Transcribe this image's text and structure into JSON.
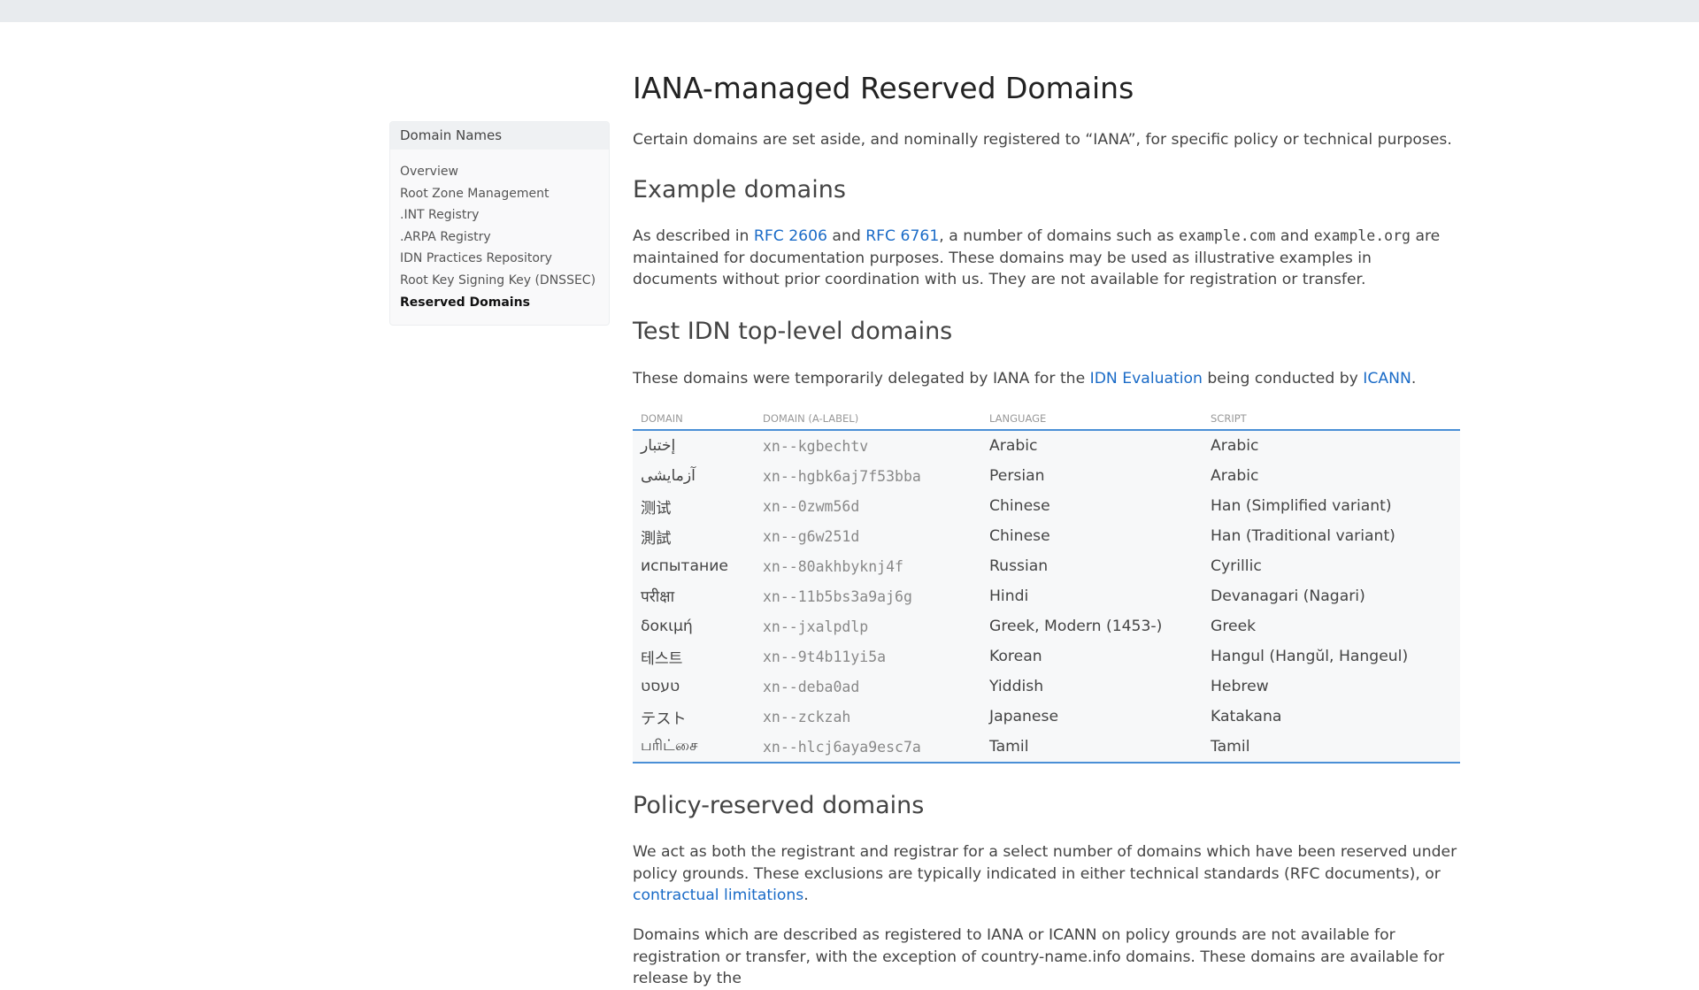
{
  "sidebar": {
    "heading": "Domain Names",
    "items": [
      {
        "label": "Overview"
      },
      {
        "label": "Root Zone Management"
      },
      {
        "label": ".INT Registry"
      },
      {
        "label": ".ARPA Registry"
      },
      {
        "label": "IDN Practices Repository"
      },
      {
        "label": "Root Key Signing Key (DNSSEC)"
      },
      {
        "label": "Reserved Domains"
      }
    ]
  },
  "main": {
    "title": "IANA-managed Reserved Domains",
    "intro": "Certain domains are set aside, and nominally registered to “IANA”, for specific policy or technical purposes.",
    "example": {
      "heading": "Example domains",
      "t1": "As described in ",
      "link1": "RFC 2606",
      "t2": " and ",
      "link2": "RFC 6761",
      "t3": ", a number of domains such as ",
      "code1": "example.com",
      "t4": " and ",
      "code2": "example.org",
      "t5": " are maintained for documentation purposes. These domains may be used as illustrative examples in documents without prior coordination with us. They are not available for registration or transfer."
    },
    "test_idn": {
      "heading": "Test IDN top-level domains",
      "t1": "These domains were temporarily delegated by IANA for the ",
      "link1": "IDN Evaluation",
      "t2": " being conducted by ",
      "link2": "ICANN",
      "t3": ".",
      "columns": {
        "domain": "DOMAIN",
        "alabel": "DOMAIN (A-LABEL)",
        "language": "LANGUAGE",
        "script": "SCRIPT"
      },
      "rows": [
        {
          "domain": "إختبار",
          "alabel": "xn--kgbechtv",
          "language": "Arabic",
          "script": "Arabic"
        },
        {
          "domain": "آزمایشی",
          "alabel": "xn--hgbk6aj7f53bba",
          "language": "Persian",
          "script": "Arabic"
        },
        {
          "domain": "测试",
          "alabel": "xn--0zwm56d",
          "language": "Chinese",
          "script": "Han (Simplified variant)"
        },
        {
          "domain": "測試",
          "alabel": "xn--g6w251d",
          "language": "Chinese",
          "script": "Han (Traditional variant)"
        },
        {
          "domain": "испытание",
          "alabel": "xn--80akhbyknj4f",
          "language": "Russian",
          "script": "Cyrillic"
        },
        {
          "domain": "परीक्षा",
          "alabel": "xn--11b5bs3a9aj6g",
          "language": "Hindi",
          "script": "Devanagari (Nagari)"
        },
        {
          "domain": "δοκιμή",
          "alabel": "xn--jxalpdlp",
          "language": "Greek, Modern (1453-)",
          "script": "Greek"
        },
        {
          "domain": "테스트",
          "alabel": "xn--9t4b11yi5a",
          "language": "Korean",
          "script": "Hangul (Hangŭl, Hangeul)"
        },
        {
          "domain": "טעסט",
          "alabel": "xn--deba0ad",
          "language": "Yiddish",
          "script": "Hebrew"
        },
        {
          "domain": "テスト",
          "alabel": "xn--zckzah",
          "language": "Japanese",
          "script": "Katakana"
        },
        {
          "domain": "பரிட்சை",
          "alabel": "xn--hlcj6aya9esc7a",
          "language": "Tamil",
          "script": "Tamil"
        }
      ]
    },
    "policy": {
      "heading": "Policy-reserved domains",
      "p1_t1": "We act as both the registrant and registrar for a select number of domains which have been reserved under policy grounds. These exclusions are typically indicated in either technical standards (RFC documents), or ",
      "p1_link": "contractual limitations",
      "p1_t2": ".",
      "p2": "Domains which are described as registered to IANA or ICANN on policy grounds are not available for registration or transfer, with the exception of country-name.info domains. These domains are available for release by the"
    }
  }
}
